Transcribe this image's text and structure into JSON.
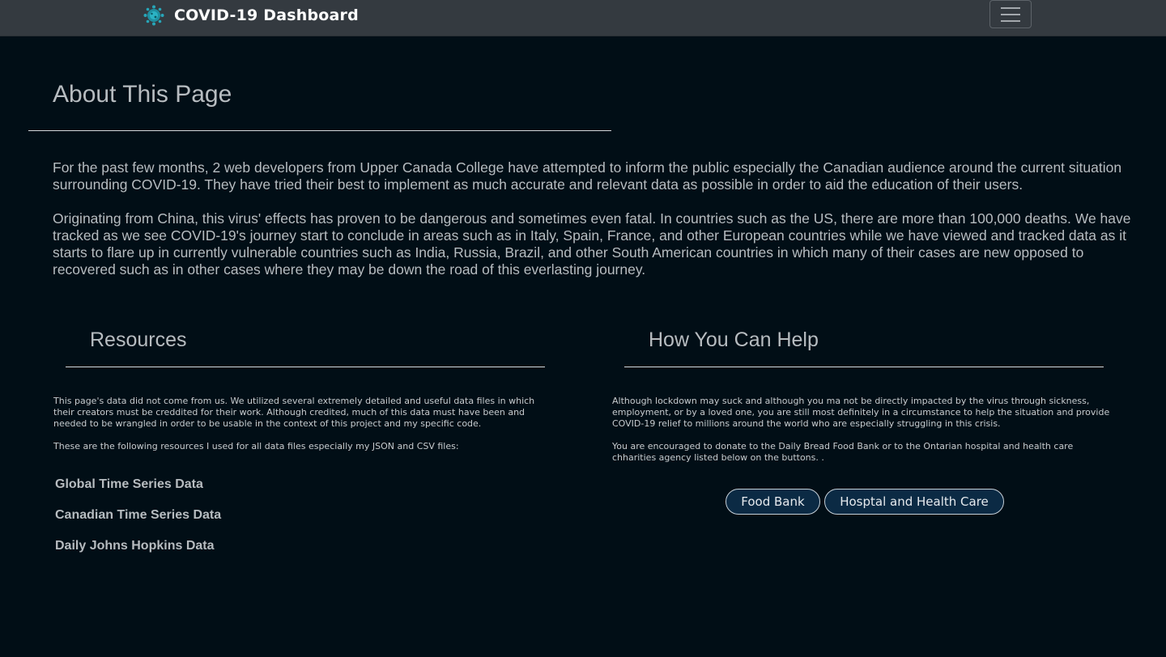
{
  "navbar": {
    "brand_title": "COVID-19 Dashboard",
    "brand_icon": "coronavirus-icon",
    "toggler_icon": "hamburger-menu-icon"
  },
  "about": {
    "title": "About This Page",
    "paragraphs": [
      "For the past few months, 2 web developers from Upper Canada College have attempted to inform the public especially the Canadian audience around the current situation surrounding COVID-19. They have tried their best to implement as much accurate and relevant data as possible in order to aid the education of their users.",
      "Originating from China, this virus' effects has proven to be dangerous and sometimes even fatal. In countries such as the US, there are more than 100,000 deaths. We have tracked as we see COVID-19's journey start to conclude in areas such as in Italy, Spain, France, and other European countries while we have viewed and tracked data as it starts to flare up in currently vulnerable countries such as India, Russia, Brazil, and other South American countries in which many of their cases are new opposed to recovered such as in other cases where they may be down the road of this everlasting journey."
    ]
  },
  "resources": {
    "title": "Resources",
    "paragraphs": [
      "This page's data did not come from us. We utilized several extremely detailed and useful data files in which their creators must be creddited for their work. Although credited, much of this data must have been and needed to be wrangled in order to be usable in the context of this project and my specific code.",
      "These are the following resources I used for all data files especially my JSON and CSV files:"
    ],
    "links": [
      "Global Time Series Data",
      "Canadian Time Series Data",
      "Daily Johns Hopkins Data"
    ]
  },
  "help": {
    "title": "How You Can Help",
    "paragraphs": [
      "Although lockdown may suck and although you ma not be directly impacted by the virus through sickness, employment, or by a loved one, you are still most definitely in a circumstance to help the situation and provide COVID-19 relief to millions around the world who are especially struggling in this crisis.",
      "You are encouraged to donate to the Daily Bread Food Bank or to the Ontarian hospital and health care chharities agency listed below on the buttons. ."
    ],
    "buttons": {
      "food_bank": "Food Bank",
      "hospital": "Hosptal and Health Care"
    }
  },
  "colors": {
    "background": "#010e16",
    "navbar": "#343a40",
    "button_fill": "#0b2a44",
    "text": "#b7bcc0"
  }
}
